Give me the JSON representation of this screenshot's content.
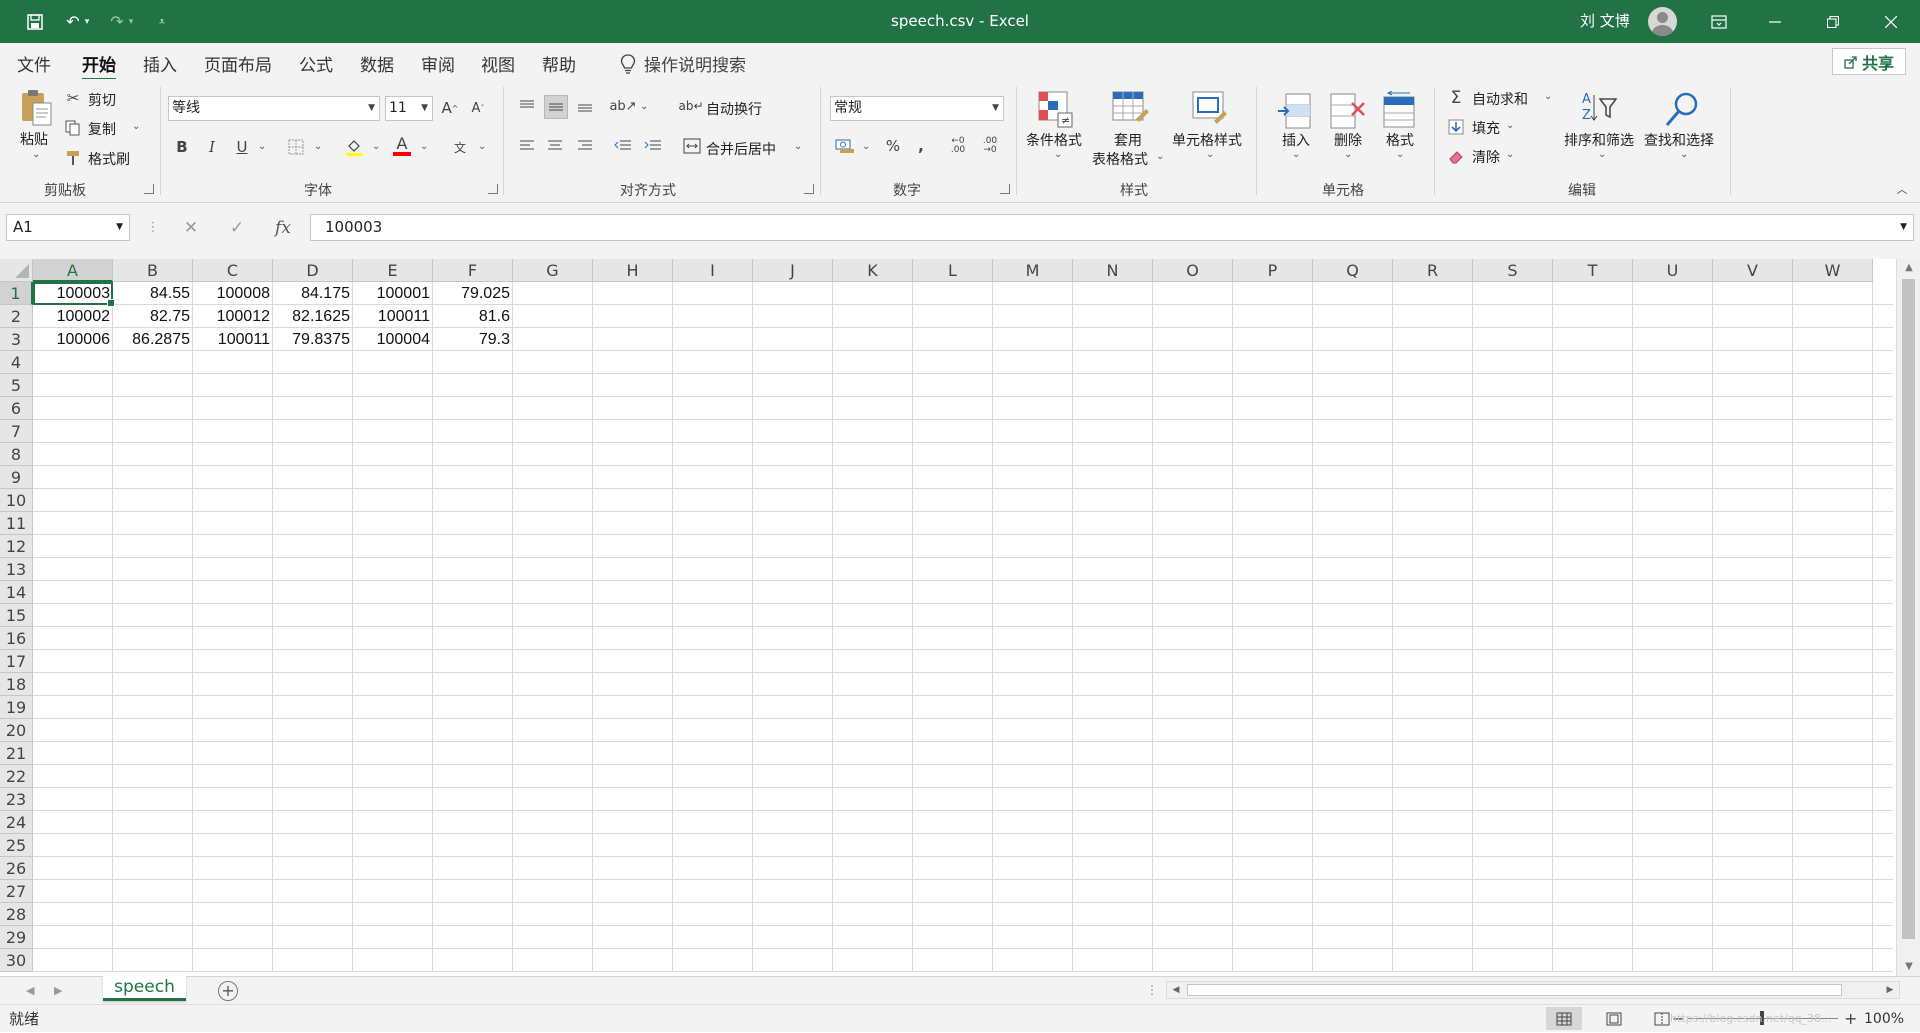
{
  "titlebar": {
    "title": "speech.csv  -  Excel",
    "user": "刘 文博",
    "bg_color": "#217346"
  },
  "tabs": {
    "items": [
      "文件",
      "开始",
      "插入",
      "页面布局",
      "公式",
      "数据",
      "审阅",
      "视图",
      "帮助"
    ],
    "active": "开始",
    "tell_me": "操作说明搜索",
    "share": "共享"
  },
  "ribbon": {
    "clipboard": {
      "paste": "粘贴",
      "cut": "剪切",
      "copy": "复制",
      "format_painter": "格式刷",
      "group": "剪贴板"
    },
    "font": {
      "name": "等线",
      "size": "11",
      "bold": "B",
      "italic": "I",
      "underline": "U",
      "group": "字体"
    },
    "alignment": {
      "wrap": "自动换行",
      "merge": "合并后居中",
      "group": "对齐方式"
    },
    "number": {
      "format": "常规",
      "percent": "%",
      "comma": ",",
      "group": "数字"
    },
    "styles": {
      "conditional": "条件格式",
      "table_line1": "套用",
      "table_line2": "表格格式",
      "cell_styles": "单元格样式",
      "group": "样式"
    },
    "cells": {
      "insert": "插入",
      "delete": "删除",
      "format": "格式",
      "group": "单元格"
    },
    "editing": {
      "autosum": "自动求和",
      "fill": "填充",
      "clear": "清除",
      "sort": "排序和筛选",
      "find": "查找和选择",
      "group": "编辑"
    }
  },
  "formula_bar": {
    "name_box": "A1",
    "fx": "fx",
    "formula": "100003"
  },
  "sheet": {
    "columns": [
      "A",
      "B",
      "C",
      "D",
      "E",
      "F",
      "G",
      "H",
      "I",
      "J",
      "K",
      "L",
      "M",
      "N",
      "O",
      "P",
      "Q",
      "R",
      "S",
      "T",
      "U",
      "V",
      "W"
    ],
    "rows": [
      "1",
      "2",
      "3",
      "4",
      "5",
      "6",
      "7",
      "8",
      "9",
      "10",
      "11",
      "12",
      "13",
      "14",
      "15",
      "16",
      "17",
      "18",
      "19",
      "20",
      "21",
      "22",
      "23",
      "24",
      "25",
      "26",
      "27",
      "28",
      "29",
      "30"
    ],
    "selected_cell": "A1",
    "data": [
      [
        "100003",
        "84.55",
        "100008",
        "84.175",
        "100001",
        "79.025"
      ],
      [
        "100002",
        "82.75",
        "100012",
        "82.1625",
        "100011",
        "81.6"
      ],
      [
        "100006",
        "86.2875",
        "100011",
        "79.8375",
        "100004",
        "79.3"
      ]
    ]
  },
  "sheet_tabs": {
    "active": "speech"
  },
  "status": {
    "ready": "就绪",
    "zoom": "100%",
    "watermark": "https://blog.csdn.net/qq_38..."
  }
}
